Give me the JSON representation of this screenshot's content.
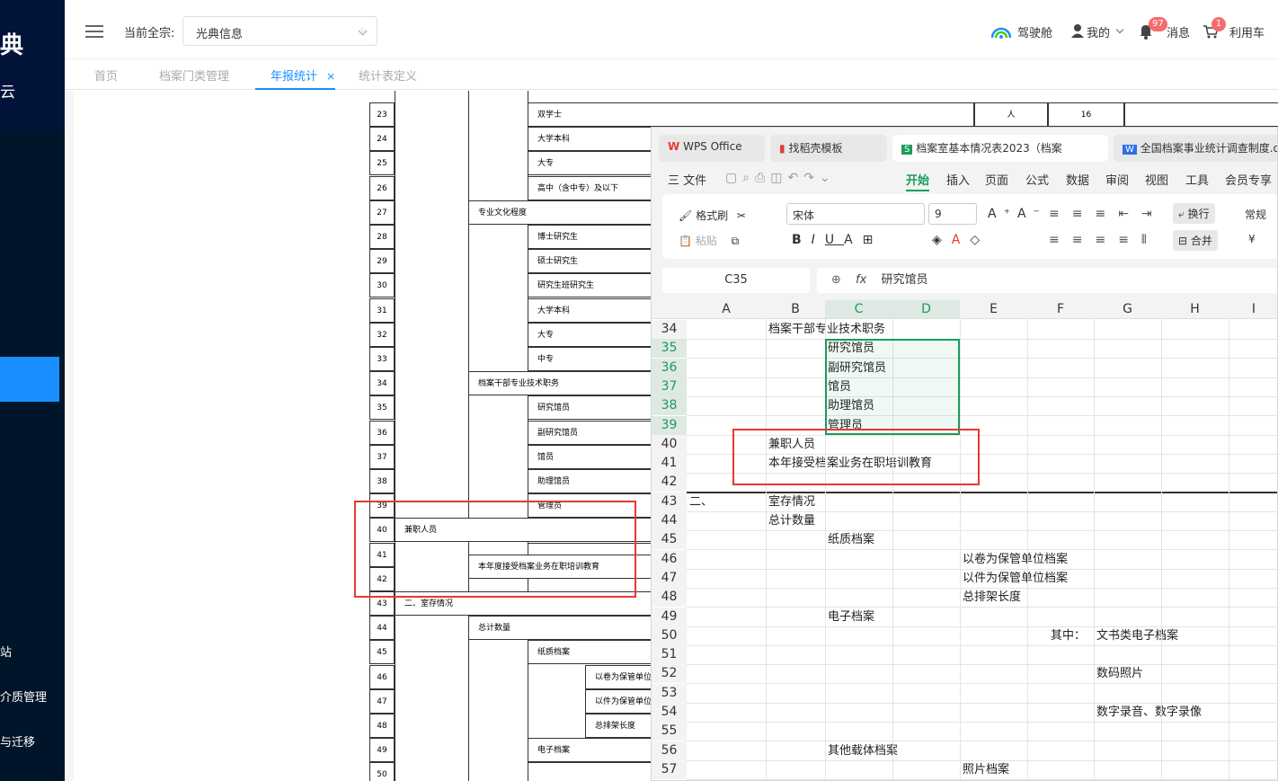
{
  "sidebar": {
    "logo_char": "典",
    "logo_sub": "云",
    "items": [
      "站",
      "介质管理",
      "与迁移"
    ]
  },
  "header": {
    "current_label": "当前全宗:",
    "current_value": "光典信息",
    "cockpit": "驾驶舱",
    "mine": "我的",
    "messages": "消息",
    "messages_count": "97",
    "cart": "利用车",
    "cart_count": "1"
  },
  "tabs": [
    {
      "label": "首页"
    },
    {
      "label": "档案门类管理"
    },
    {
      "label": "年报统计",
      "close": "×"
    },
    {
      "label": "统计表定义"
    }
  ],
  "grid": {
    "rows": [
      {
        "n": "23",
        "text": "双学士",
        "unit": "人",
        "val": "16"
      },
      {
        "n": "24",
        "text": "大学本科"
      },
      {
        "n": "25",
        "text": "大专"
      },
      {
        "n": "26",
        "text": "高中（含中专）及以下"
      },
      {
        "n": "27",
        "text": "专业文化程度"
      },
      {
        "n": "28",
        "text": "博士研究生"
      },
      {
        "n": "29",
        "text": "硕士研究生"
      },
      {
        "n": "30",
        "text": "研究生班研究生"
      },
      {
        "n": "31",
        "text": "大学本科"
      },
      {
        "n": "32",
        "text": "大专"
      },
      {
        "n": "33",
        "text": "中专"
      },
      {
        "n": "34",
        "text": "档案干部专业技术职务"
      },
      {
        "n": "35",
        "text": "研究馆员"
      },
      {
        "n": "36",
        "text": "副研究馆员"
      },
      {
        "n": "37",
        "text": "馆员"
      },
      {
        "n": "38",
        "text": "助理馆员"
      },
      {
        "n": "39",
        "text": "管理员"
      },
      {
        "n": "40",
        "text": "兼职人员"
      },
      {
        "n": "41",
        "text": ""
      },
      {
        "n": "42",
        "text": "本年度接受档案业务在职培训教育"
      },
      {
        "n": "43",
        "text": "二、室存情况"
      },
      {
        "n": "44",
        "text": "总计数量"
      },
      {
        "n": "45",
        "text": "纸质档案"
      },
      {
        "n": "46",
        "text": "以卷为保管单位"
      },
      {
        "n": "47",
        "text": "以件为保管单位"
      },
      {
        "n": "48",
        "text": "总排架长度"
      },
      {
        "n": "49",
        "text": "电子档案"
      },
      {
        "n": "50",
        "text": ""
      }
    ]
  },
  "wps": {
    "tabs": [
      "WPS Office",
      "找稻壳模板",
      "档案室基本情况表2023（档案",
      "全国档案事业统计调查制度.d"
    ],
    "menu": [
      "三 文件",
      "开始",
      "插入",
      "页面",
      "公式",
      "数据",
      "审阅",
      "视图",
      "工具",
      "会员专享"
    ],
    "ribbon": {
      "format_painter": "格式刷",
      "paste": "粘贴",
      "font": "宋体",
      "size": "9",
      "wrap": "换行",
      "merge": "合并",
      "normal": "常规"
    },
    "cell_ref": "C35",
    "formula": "研究馆员",
    "columns": [
      "A",
      "B",
      "C",
      "D",
      "E",
      "F",
      "G",
      "H",
      "I"
    ],
    "rows": [
      {
        "n": "34",
        "cells": [
          {
            "col": "B",
            "t": "档案干部专业技术职务"
          }
        ]
      },
      {
        "n": "35",
        "cells": [
          {
            "col": "C",
            "t": "研究馆员"
          }
        ]
      },
      {
        "n": "36",
        "cells": [
          {
            "col": "C",
            "t": "副研究馆员"
          }
        ]
      },
      {
        "n": "37",
        "cells": [
          {
            "col": "C",
            "t": "馆员"
          }
        ]
      },
      {
        "n": "38",
        "cells": [
          {
            "col": "C",
            "t": "助理馆员"
          }
        ]
      },
      {
        "n": "39",
        "cells": [
          {
            "col": "C",
            "t": "管理员"
          }
        ]
      },
      {
        "n": "40",
        "cells": [
          {
            "col": "B",
            "t": "兼职人员"
          }
        ]
      },
      {
        "n": "41",
        "cells": [
          {
            "col": "B",
            "t": "本年接受档案业务在职培训教育"
          }
        ]
      },
      {
        "n": "42",
        "cells": []
      },
      {
        "n": "43",
        "cells": [
          {
            "col": "A",
            "t": "二、"
          },
          {
            "col": "B",
            "t": "室存情况"
          }
        ]
      },
      {
        "n": "44",
        "cells": [
          {
            "col": "B",
            "t": "总计数量"
          }
        ]
      },
      {
        "n": "45",
        "cells": [
          {
            "col": "C",
            "t": "纸质档案"
          }
        ]
      },
      {
        "n": "46",
        "cells": [
          {
            "col": "E",
            "t": "以卷为保管单位档案"
          }
        ]
      },
      {
        "n": "47",
        "cells": [
          {
            "col": "E",
            "t": "以件为保管单位档案"
          }
        ]
      },
      {
        "n": "48",
        "cells": [
          {
            "col": "E",
            "t": "总排架长度"
          }
        ]
      },
      {
        "n": "49",
        "cells": [
          {
            "col": "C",
            "t": "电子档案"
          }
        ]
      },
      {
        "n": "50",
        "cells": [
          {
            "col": "F",
            "t": "其中："
          },
          {
            "col": "G",
            "t": "文书类电子档案"
          }
        ]
      },
      {
        "n": "51",
        "cells": []
      },
      {
        "n": "52",
        "cells": [
          {
            "col": "G",
            "t": "数码照片"
          }
        ]
      },
      {
        "n": "53",
        "cells": []
      },
      {
        "n": "54",
        "cells": [
          {
            "col": "G",
            "t": "数字录音、数字录像"
          }
        ]
      },
      {
        "n": "55",
        "cells": []
      },
      {
        "n": "56",
        "cells": [
          {
            "col": "C",
            "t": "其他载体档案"
          }
        ]
      },
      {
        "n": "57",
        "cells": [
          {
            "col": "E",
            "t": "照片档案"
          }
        ]
      }
    ]
  }
}
